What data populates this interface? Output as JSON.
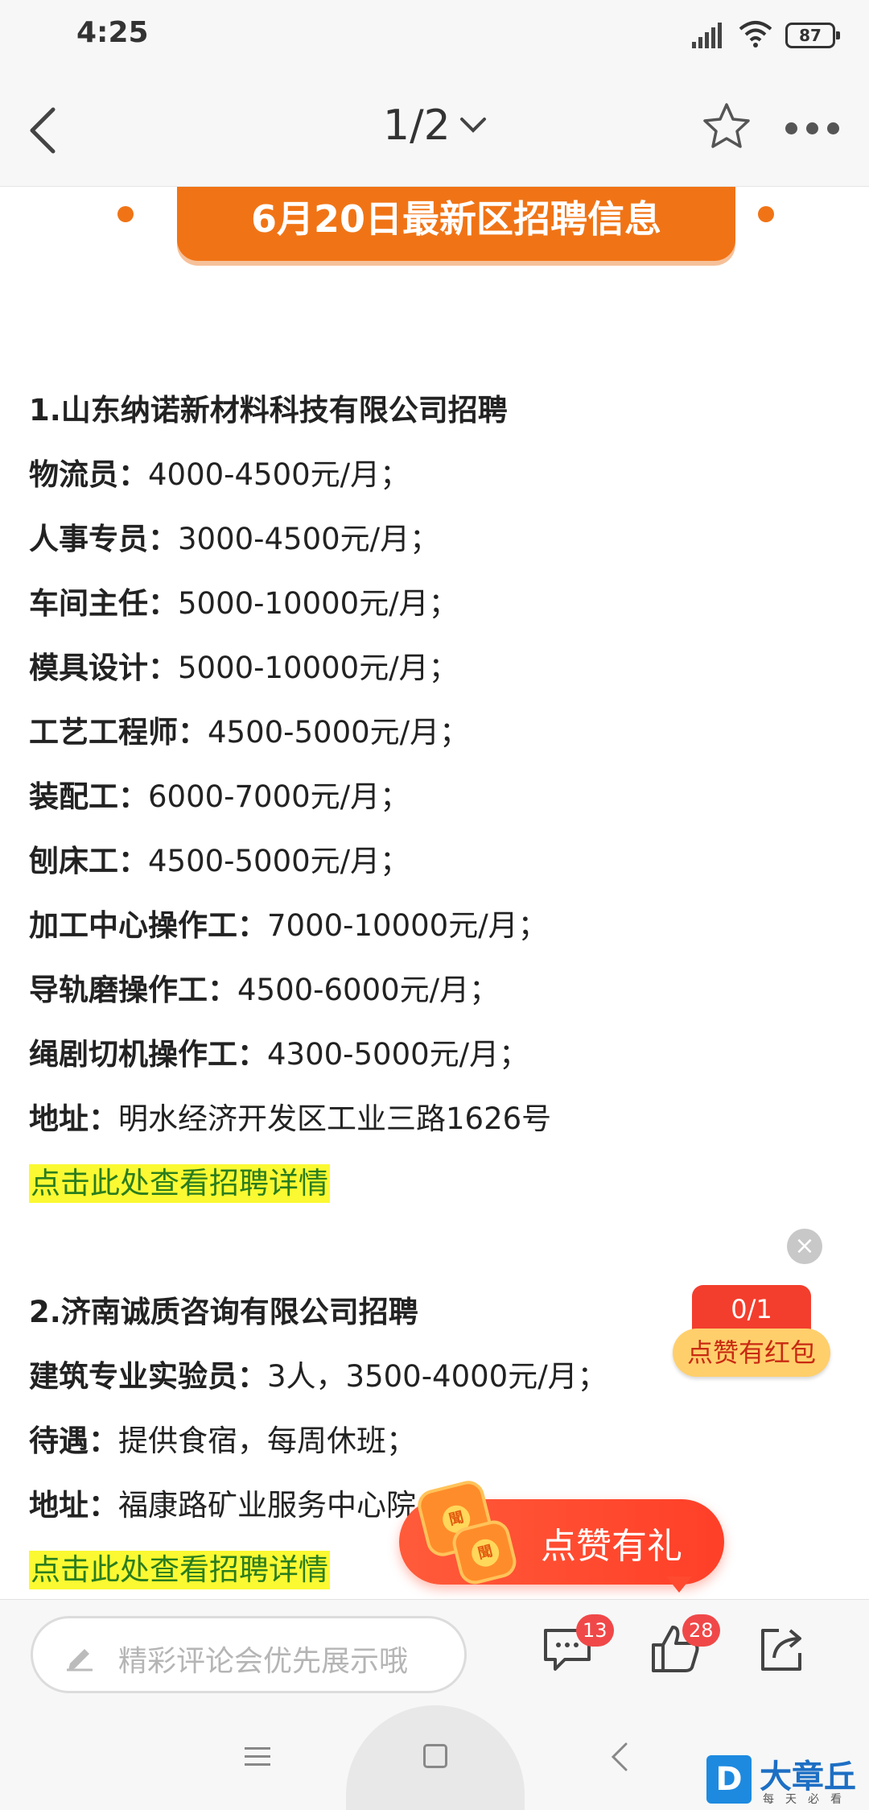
{
  "status_bar": {
    "time": "4:25",
    "battery": "87"
  },
  "nav": {
    "page_indicator": "1/2"
  },
  "banner": {
    "text": "6月20日最新区招聘信息"
  },
  "article": {
    "company1": {
      "title": "1.山东纳诺新材料科技有限公司招聘",
      "jobs": [
        {
          "label": "物流员：",
          "value": "4000-4500元/月；"
        },
        {
          "label": "人事专员：",
          "value": "3000-4500元/月；"
        },
        {
          "label": "车间主任：",
          "value": "5000-10000元/月；"
        },
        {
          "label": "模具设计：",
          "value": "5000-10000元/月；"
        },
        {
          "label": "工艺工程师：",
          "value": "4500-5000元/月；"
        },
        {
          "label": "装配工：",
          "value": "6000-7000元/月；"
        },
        {
          "label": "刨床工：",
          "value": "4500-5000元/月；"
        },
        {
          "label": "加工中心操作工：",
          "value": "7000-10000元/月；"
        },
        {
          "label": "导轨磨操作工：",
          "value": "4500-6000元/月；"
        },
        {
          "label": "绳剧切机操作工：",
          "value": "4300-5000元/月；"
        }
      ],
      "address_label": "地址：",
      "address": "明水经济开发区工业三路1626号",
      "link": "点击此处查看招聘详情"
    },
    "company2": {
      "title": "2.济南诚质咨询有限公司招聘",
      "job_label": "建筑专业实验员：",
      "job_value": "3人，3500-4000元/月；",
      "benefits_label": "待遇：",
      "benefits": "提供食宿，每周休班；",
      "address_label": "地址：",
      "address": "福康路矿业服务中心院",
      "link": "点击此处查看招聘详情"
    }
  },
  "reward": {
    "count": "0/1",
    "label": "点赞有红包"
  },
  "like_gift": {
    "label": "点赞有礼"
  },
  "action_bar": {
    "comment_placeholder": "精彩评论会优先展示哦",
    "comment_count": "13",
    "like_count": "28"
  },
  "watermark": {
    "logo": "D",
    "title": "大章丘",
    "subtitle": "每天必看"
  },
  "colors": {
    "accent": "#f07416",
    "link_bg": "#fbf932",
    "link_text": "#2a7d1e",
    "badge": "#f04848"
  }
}
